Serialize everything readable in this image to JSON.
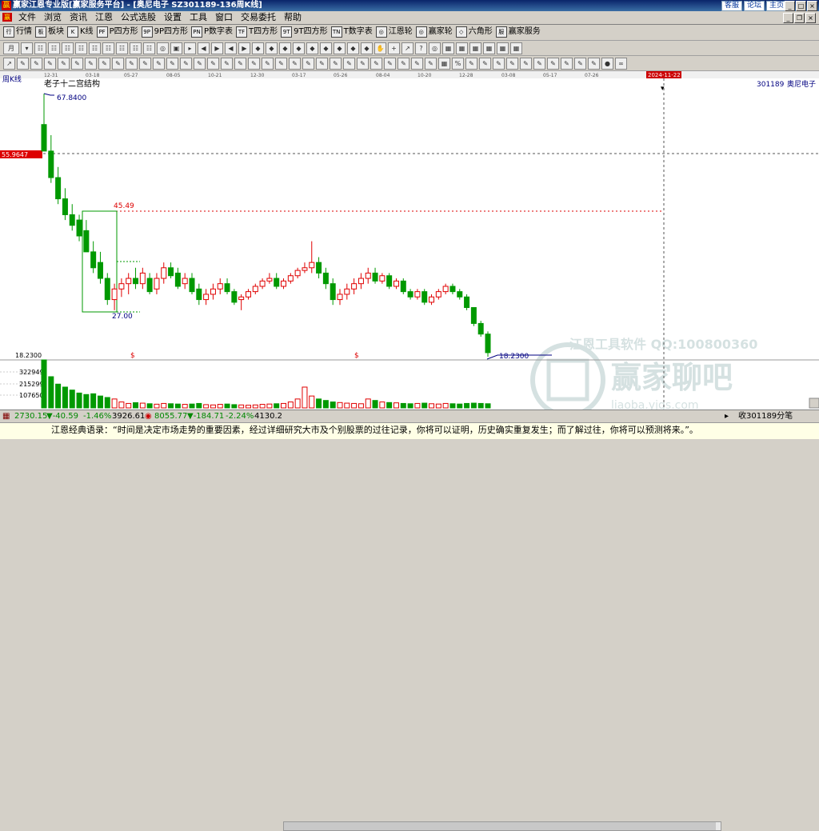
{
  "window": {
    "logo": "赢",
    "title": "赢家江恩专业版[赢家服务平台] - [奥尼电子   SZ301189-136周K线]",
    "links": [
      "客服",
      "论坛",
      "主页"
    ]
  },
  "menu": {
    "icon": "赢",
    "items": [
      "文件",
      "浏览",
      "资讯",
      "江恩",
      "公式选股",
      "设置",
      "工具",
      "窗口",
      "交易委托",
      "帮助"
    ]
  },
  "toolbar1": {
    "buttons": [
      {
        "icon": "行",
        "label": "行情"
      },
      {
        "icon": "板",
        "label": "板块"
      },
      {
        "icon": "K",
        "label": "K线"
      },
      {
        "icon": "PF",
        "label": "P四方形"
      },
      {
        "icon": "9P",
        "label": "9P四方形"
      },
      {
        "icon": "PN",
        "label": "P数字表"
      },
      {
        "icon": "TF",
        "label": "T四方形"
      },
      {
        "icon": "9T",
        "label": "9T四方形"
      },
      {
        "icon": "TN",
        "label": "T数字表"
      },
      {
        "icon": "◎",
        "label": "江恩轮"
      },
      {
        "icon": "◎",
        "label": "赢家轮"
      },
      {
        "icon": "◇",
        "label": "六角形"
      },
      {
        "icon": "服",
        "label": "赢家服务"
      }
    ]
  },
  "toolbar2": {
    "period": "月",
    "icons": [
      "▾",
      "☷",
      "☷",
      "☷",
      "☷",
      "☷",
      "☷",
      "☷",
      "☷",
      "☷",
      "◎",
      "▣",
      "▸",
      "◀",
      "▶",
      "◀",
      "▶",
      "◆",
      "◆",
      "◆",
      "◆",
      "◆",
      "◆",
      "◆",
      "◆",
      "◆",
      "✋",
      "+",
      "↗",
      "?",
      "◎",
      "▦",
      "▦",
      "▦",
      "▦",
      "▦",
      "▦"
    ]
  },
  "toolbar3": {
    "icons": [
      "↗",
      "✎",
      "✎",
      "✎",
      "✎",
      "✎",
      "✎",
      "✎",
      "✎",
      "✎",
      "✎",
      "✎",
      "✎",
      "✎",
      "✎",
      "✎",
      "✎",
      "✎",
      "✎",
      "✎",
      "✎",
      "✎",
      "✎",
      "✎",
      "✎",
      "✎",
      "✎",
      "✎",
      "✎",
      "✎",
      "✎",
      "✎",
      "▦",
      "%",
      "✎",
      "✎",
      "✎",
      "✎",
      "✎",
      "✎",
      "✎",
      "✎",
      "✎",
      "✎",
      "●",
      "∞"
    ]
  },
  "chart": {
    "period_label": "周K线",
    "stock_code": "301189",
    "stock_name": "奥尼电子",
    "date_ticks": [
      "12-31",
      "03-18",
      "05-27",
      "08-05",
      "10-21",
      "12-30",
      "03-17",
      "05-26",
      "08-04",
      "10-20",
      "12-28",
      "03-08",
      "05-17",
      "07-26"
    ],
    "cursor_date": "2024-11-22",
    "cursor_price": "55.9647",
    "structure_label": "老子十二宫结构",
    "high_label": "67.8400",
    "box_top_label": "45.49",
    "box_bottom_label": "27.00",
    "low_label": "18.2300",
    "price_scale_low": "18.2300",
    "dollar_marks": [
      "$",
      "$"
    ],
    "volume_ticks": [
      "322949",
      "215299",
      "107650"
    ],
    "watermark_company": "江恩工具软件  QQ:100800360",
    "watermark_brand": "赢家聊吧",
    "watermark_url": "liaoba.yjgs.com",
    "colors": {
      "up": "#e00000",
      "down": "#009900",
      "box": "#009900",
      "label": "#000080"
    }
  },
  "chart_data": {
    "type": "candlestick",
    "title": "奥尼电子 周K线",
    "candles": [
      [
        62,
        67.8,
        57,
        57
      ],
      [
        57,
        60,
        51,
        52
      ],
      [
        52,
        54,
        47,
        48
      ],
      [
        48,
        50,
        44,
        45
      ],
      [
        45,
        47,
        42,
        43
      ],
      [
        44,
        45,
        40,
        41
      ],
      [
        42,
        44,
        38,
        38
      ],
      [
        38,
        40,
        34,
        35
      ],
      [
        36,
        38,
        32,
        33
      ],
      [
        33,
        34,
        28,
        29
      ],
      [
        29,
        32,
        27,
        31
      ],
      [
        31,
        33,
        29.5,
        32
      ],
      [
        32,
        34,
        30,
        33
      ],
      [
        33,
        35,
        31,
        32
      ],
      [
        32,
        35,
        31,
        34
      ],
      [
        33,
        34,
        30,
        30.5
      ],
      [
        31,
        34,
        30,
        33
      ],
      [
        33,
        36,
        32,
        35
      ],
      [
        35,
        36,
        33,
        33.5
      ],
      [
        34,
        35,
        31,
        31.5
      ],
      [
        32,
        34,
        31,
        33
      ],
      [
        33,
        34,
        30,
        30.5
      ],
      [
        31,
        32,
        28,
        29
      ],
      [
        29,
        31,
        28,
        30
      ],
      [
        30,
        32,
        29,
        31
      ],
      [
        31,
        33,
        30,
        32
      ],
      [
        32,
        33,
        30,
        30.5
      ],
      [
        30.5,
        31,
        28,
        28.5
      ],
      [
        29,
        30,
        27,
        29.5
      ],
      [
        29.5,
        31,
        29,
        30.5
      ],
      [
        30.5,
        32,
        30,
        31.5
      ],
      [
        31.5,
        33,
        31,
        32.5
      ],
      [
        32.5,
        34,
        32,
        33
      ],
      [
        33,
        34,
        31,
        31.5
      ],
      [
        31.5,
        33,
        31,
        32.5
      ],
      [
        32.5,
        34,
        32,
        33.5
      ],
      [
        33.5,
        35,
        33,
        34.5
      ],
      [
        34.5,
        36,
        34,
        35
      ],
      [
        35,
        40,
        34,
        36
      ],
      [
        36,
        37,
        33,
        34
      ],
      [
        34,
        35,
        31,
        32
      ],
      [
        32,
        33,
        28,
        29
      ],
      [
        29,
        31,
        28,
        30
      ],
      [
        30,
        32,
        29,
        31
      ],
      [
        31,
        33,
        30,
        32
      ],
      [
        32,
        34,
        31,
        33
      ],
      [
        33,
        35,
        32,
        34
      ],
      [
        34,
        35,
        32,
        32.5
      ],
      [
        32.5,
        34,
        32,
        33.5
      ],
      [
        33.5,
        34,
        31,
        31.5
      ],
      [
        31.5,
        33,
        31,
        32.5
      ],
      [
        32.5,
        33,
        30,
        30.5
      ],
      [
        30.5,
        31,
        29,
        29.5
      ],
      [
        29.5,
        31,
        29,
        30.5
      ],
      [
        30.5,
        31,
        28,
        28.5
      ],
      [
        28.5,
        30,
        28,
        29.5
      ],
      [
        29.5,
        31,
        29,
        30.5
      ],
      [
        30.5,
        32,
        30,
        31.5
      ],
      [
        31.5,
        32,
        30,
        30.5
      ],
      [
        30.5,
        31,
        29,
        29.5
      ],
      [
        29.5,
        30,
        27,
        27.5
      ],
      [
        27.5,
        25,
        24,
        24.5
      ],
      [
        24.5,
        25,
        22,
        22.5
      ],
      [
        22.5,
        23,
        18.23,
        19
      ]
    ],
    "volume": [
      322949,
      210000,
      160000,
      140000,
      120000,
      100000,
      90000,
      95000,
      80000,
      70000,
      60000,
      40000,
      30000,
      35000,
      32000,
      28000,
      25000,
      30000,
      28000,
      26000,
      24000,
      26000,
      30000,
      22000,
      20000,
      24000,
      26000,
      22000,
      20000,
      18000,
      20000,
      24000,
      26000,
      28000,
      30000,
      40000,
      60000,
      140000,
      80000,
      60000,
      50000,
      40000,
      36000,
      32000,
      30000,
      28000,
      60000,
      50000,
      40000,
      36000,
      34000,
      30000,
      28000,
      30000,
      32000,
      28000,
      26000,
      30000,
      28000,
      26000,
      30000,
      32000,
      30000,
      28000
    ],
    "ylim": [
      18.23,
      67.84
    ],
    "volume_ticks": [
      322949,
      215299,
      107650
    ]
  },
  "status": {
    "sh_index": "2730.15",
    "sh_change": "▼-40.59",
    "sh_pct": "-1.46%",
    "sh_amount": "3926.61",
    "sz_index": "8055.77",
    "sz_change": "▼-184.71",
    "sz_pct": "-2.24%",
    "sz_amount": "4130.2",
    "right_text": "收301189分笔"
  },
  "quote": {
    "text": "江恩经典语录：“时间是决定市场走势的重要因素，经过详细研究大市及个别股票的过往记录，你将可以证明，历史确实重复发生；而了解过往，你将可以预测将来。”。"
  }
}
